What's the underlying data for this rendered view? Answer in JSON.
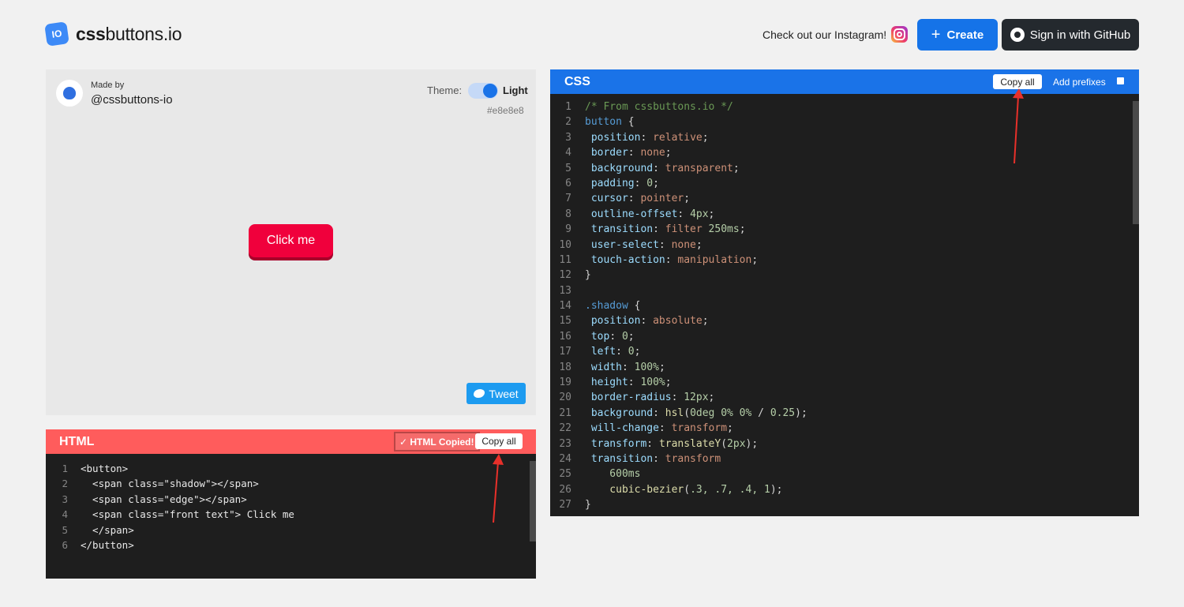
{
  "header": {
    "logo_badge": "IO",
    "logo_bold": "css",
    "logo_rest": "buttons.io",
    "instagram_label": "Check out our Instagram!",
    "create_label": "Create",
    "github_label": "Sign in with GitHub"
  },
  "preview": {
    "made_by_label": "Made by",
    "author": "@cssbuttons-io",
    "theme_label": "Theme:",
    "theme_value": "Light",
    "background_hex": "#e8e8e8",
    "demo_button_label": "Click me",
    "tweet_label": "Tweet"
  },
  "html_panel": {
    "title": "HTML",
    "copied_status": "✓ HTML Copied!",
    "copy_label": "Copy all",
    "lines": [
      "<button>",
      "  <span class=\"shadow\"></span>",
      "  <span class=\"edge\"></span>",
      "  <span class=\"front text\"> Click me",
      "  </span>",
      "</button>"
    ]
  },
  "css_panel": {
    "title": "CSS",
    "copy_label": "Copy all",
    "prefix_label": "Add prefixes",
    "prefix_checked": false,
    "lines": [
      [
        [
          "c-comment",
          "/* From cssbuttons.io */"
        ]
      ],
      [
        [
          "c-sel",
          "button"
        ],
        [
          "c-plain",
          " {"
        ]
      ],
      [
        [
          "c-prop",
          " position"
        ],
        [
          "c-plain",
          ": "
        ],
        [
          "c-val",
          "relative"
        ],
        [
          "c-plain",
          ";"
        ]
      ],
      [
        [
          "c-prop",
          " border"
        ],
        [
          "c-plain",
          ": "
        ],
        [
          "c-val",
          "none"
        ],
        [
          "c-plain",
          ";"
        ]
      ],
      [
        [
          "c-prop",
          " background"
        ],
        [
          "c-plain",
          ": "
        ],
        [
          "c-val",
          "transparent"
        ],
        [
          "c-plain",
          ";"
        ]
      ],
      [
        [
          "c-prop",
          " padding"
        ],
        [
          "c-plain",
          ": "
        ],
        [
          "c-num",
          "0"
        ],
        [
          "c-plain",
          ";"
        ]
      ],
      [
        [
          "c-prop",
          " cursor"
        ],
        [
          "c-plain",
          ": "
        ],
        [
          "c-val",
          "pointer"
        ],
        [
          "c-plain",
          ";"
        ]
      ],
      [
        [
          "c-prop",
          " outline-offset"
        ],
        [
          "c-plain",
          ": "
        ],
        [
          "c-num",
          "4px"
        ],
        [
          "c-plain",
          ";"
        ]
      ],
      [
        [
          "c-prop",
          " transition"
        ],
        [
          "c-plain",
          ": "
        ],
        [
          "c-val",
          "filter "
        ],
        [
          "c-num",
          "250ms"
        ],
        [
          "c-plain",
          ";"
        ]
      ],
      [
        [
          "c-prop",
          " user-select"
        ],
        [
          "c-plain",
          ": "
        ],
        [
          "c-val",
          "none"
        ],
        [
          "c-plain",
          ";"
        ]
      ],
      [
        [
          "c-prop",
          " touch-action"
        ],
        [
          "c-plain",
          ": "
        ],
        [
          "c-val",
          "manipulation"
        ],
        [
          "c-plain",
          ";"
        ]
      ],
      [
        [
          "c-plain",
          "}"
        ]
      ],
      [],
      [
        [
          "c-sel",
          ".shadow"
        ],
        [
          "c-plain",
          " {"
        ]
      ],
      [
        [
          "c-prop",
          " position"
        ],
        [
          "c-plain",
          ": "
        ],
        [
          "c-val",
          "absolute"
        ],
        [
          "c-plain",
          ";"
        ]
      ],
      [
        [
          "c-prop",
          " top"
        ],
        [
          "c-plain",
          ": "
        ],
        [
          "c-num",
          "0"
        ],
        [
          "c-plain",
          ";"
        ]
      ],
      [
        [
          "c-prop",
          " left"
        ],
        [
          "c-plain",
          ": "
        ],
        [
          "c-num",
          "0"
        ],
        [
          "c-plain",
          ";"
        ]
      ],
      [
        [
          "c-prop",
          " width"
        ],
        [
          "c-plain",
          ": "
        ],
        [
          "c-num",
          "100%"
        ],
        [
          "c-plain",
          ";"
        ]
      ],
      [
        [
          "c-prop",
          " height"
        ],
        [
          "c-plain",
          ": "
        ],
        [
          "c-num",
          "100%"
        ],
        [
          "c-plain",
          ";"
        ]
      ],
      [
        [
          "c-prop",
          " border-radius"
        ],
        [
          "c-plain",
          ": "
        ],
        [
          "c-num",
          "12px"
        ],
        [
          "c-plain",
          ";"
        ]
      ],
      [
        [
          "c-prop",
          " background"
        ],
        [
          "c-plain",
          ": "
        ],
        [
          "c-fn",
          "hsl"
        ],
        [
          "c-plain",
          "("
        ],
        [
          "c-num",
          "0deg 0% 0%"
        ],
        [
          "c-plain",
          " / "
        ],
        [
          "c-num",
          "0.25"
        ],
        [
          "c-plain",
          ");"
        ]
      ],
      [
        [
          "c-prop",
          " will-change"
        ],
        [
          "c-plain",
          ": "
        ],
        [
          "c-val",
          "transform"
        ],
        [
          "c-plain",
          ";"
        ]
      ],
      [
        [
          "c-prop",
          " transform"
        ],
        [
          "c-plain",
          ": "
        ],
        [
          "c-fn",
          "translateY"
        ],
        [
          "c-plain",
          "("
        ],
        [
          "c-num",
          "2px"
        ],
        [
          "c-plain",
          ");"
        ]
      ],
      [
        [
          "c-prop",
          " transition"
        ],
        [
          "c-plain",
          ": "
        ],
        [
          "c-val",
          "transform"
        ]
      ],
      [
        [
          "c-num",
          "    600ms"
        ]
      ],
      [
        [
          "c-fn",
          "    cubic-bezier"
        ],
        [
          "c-plain",
          "("
        ],
        [
          "c-num",
          ".3, .7, .4, 1"
        ],
        [
          "c-plain",
          ");"
        ]
      ],
      [
        [
          "c-plain",
          "}"
        ]
      ]
    ]
  },
  "colors": {
    "page_bg": "#f1f1f1",
    "preview_bg": "#e8e8e8",
    "html_header": "#ff5c5c",
    "css_header": "#1a73e8",
    "code_bg": "#1e1e1e",
    "demo_button": "#f0003c",
    "annotation_arrow": "#e8302a"
  },
  "icons": {
    "instagram": "instagram-icon",
    "create": "plus-icon",
    "github": "github-icon",
    "tweet": "twitter-icon",
    "author_avatar": "avatar-icon"
  }
}
